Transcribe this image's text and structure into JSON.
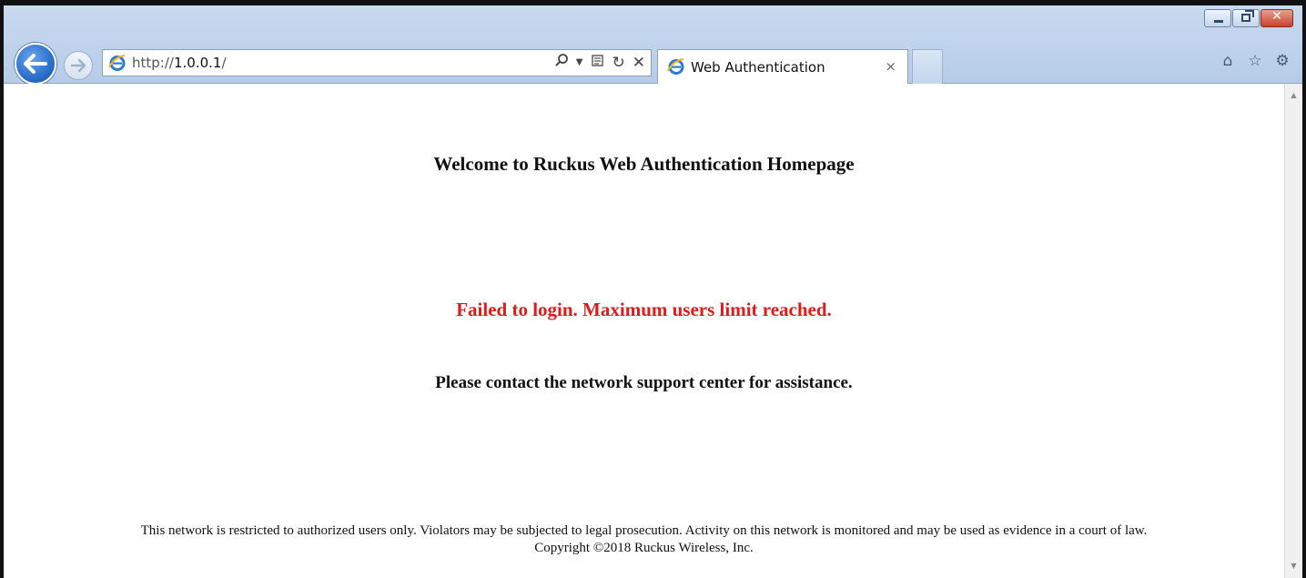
{
  "browser": {
    "address": {
      "prefix": "http://",
      "host": "1.0.0.1",
      "suffix": "/"
    },
    "tab": {
      "title": "Web Authentication",
      "close": "×"
    },
    "window_controls": {
      "close_glyph": "✕"
    }
  },
  "page": {
    "welcome": "Welcome to Ruckus Web Authentication Homepage",
    "error": "Failed to login. Maximum users limit reached.",
    "contact": "Please contact the network support center for assistance.",
    "footer_notice": "This network is restricted to authorized users only. Violators may be subjected to legal prosecution. Activity on this network is monitored and may be used as evidence in a court of law.",
    "copyright": "Copyright ©2018 Ruckus Wireless, Inc."
  },
  "colors": {
    "error_text": "#e01b1b",
    "chrome_background": "#bfd3ec"
  },
  "icons": {
    "back": "back-arrow-icon",
    "forward": "forward-arrow-icon",
    "site": "ie-logo-icon",
    "search": "search-icon",
    "dropdown": "dropdown-arrow-icon",
    "compatibility": "compatibility-view-icon",
    "refresh": "refresh-icon",
    "stop": "stop-icon",
    "home": "home-icon",
    "favorites": "star-icon",
    "tools": "gear-icon"
  }
}
